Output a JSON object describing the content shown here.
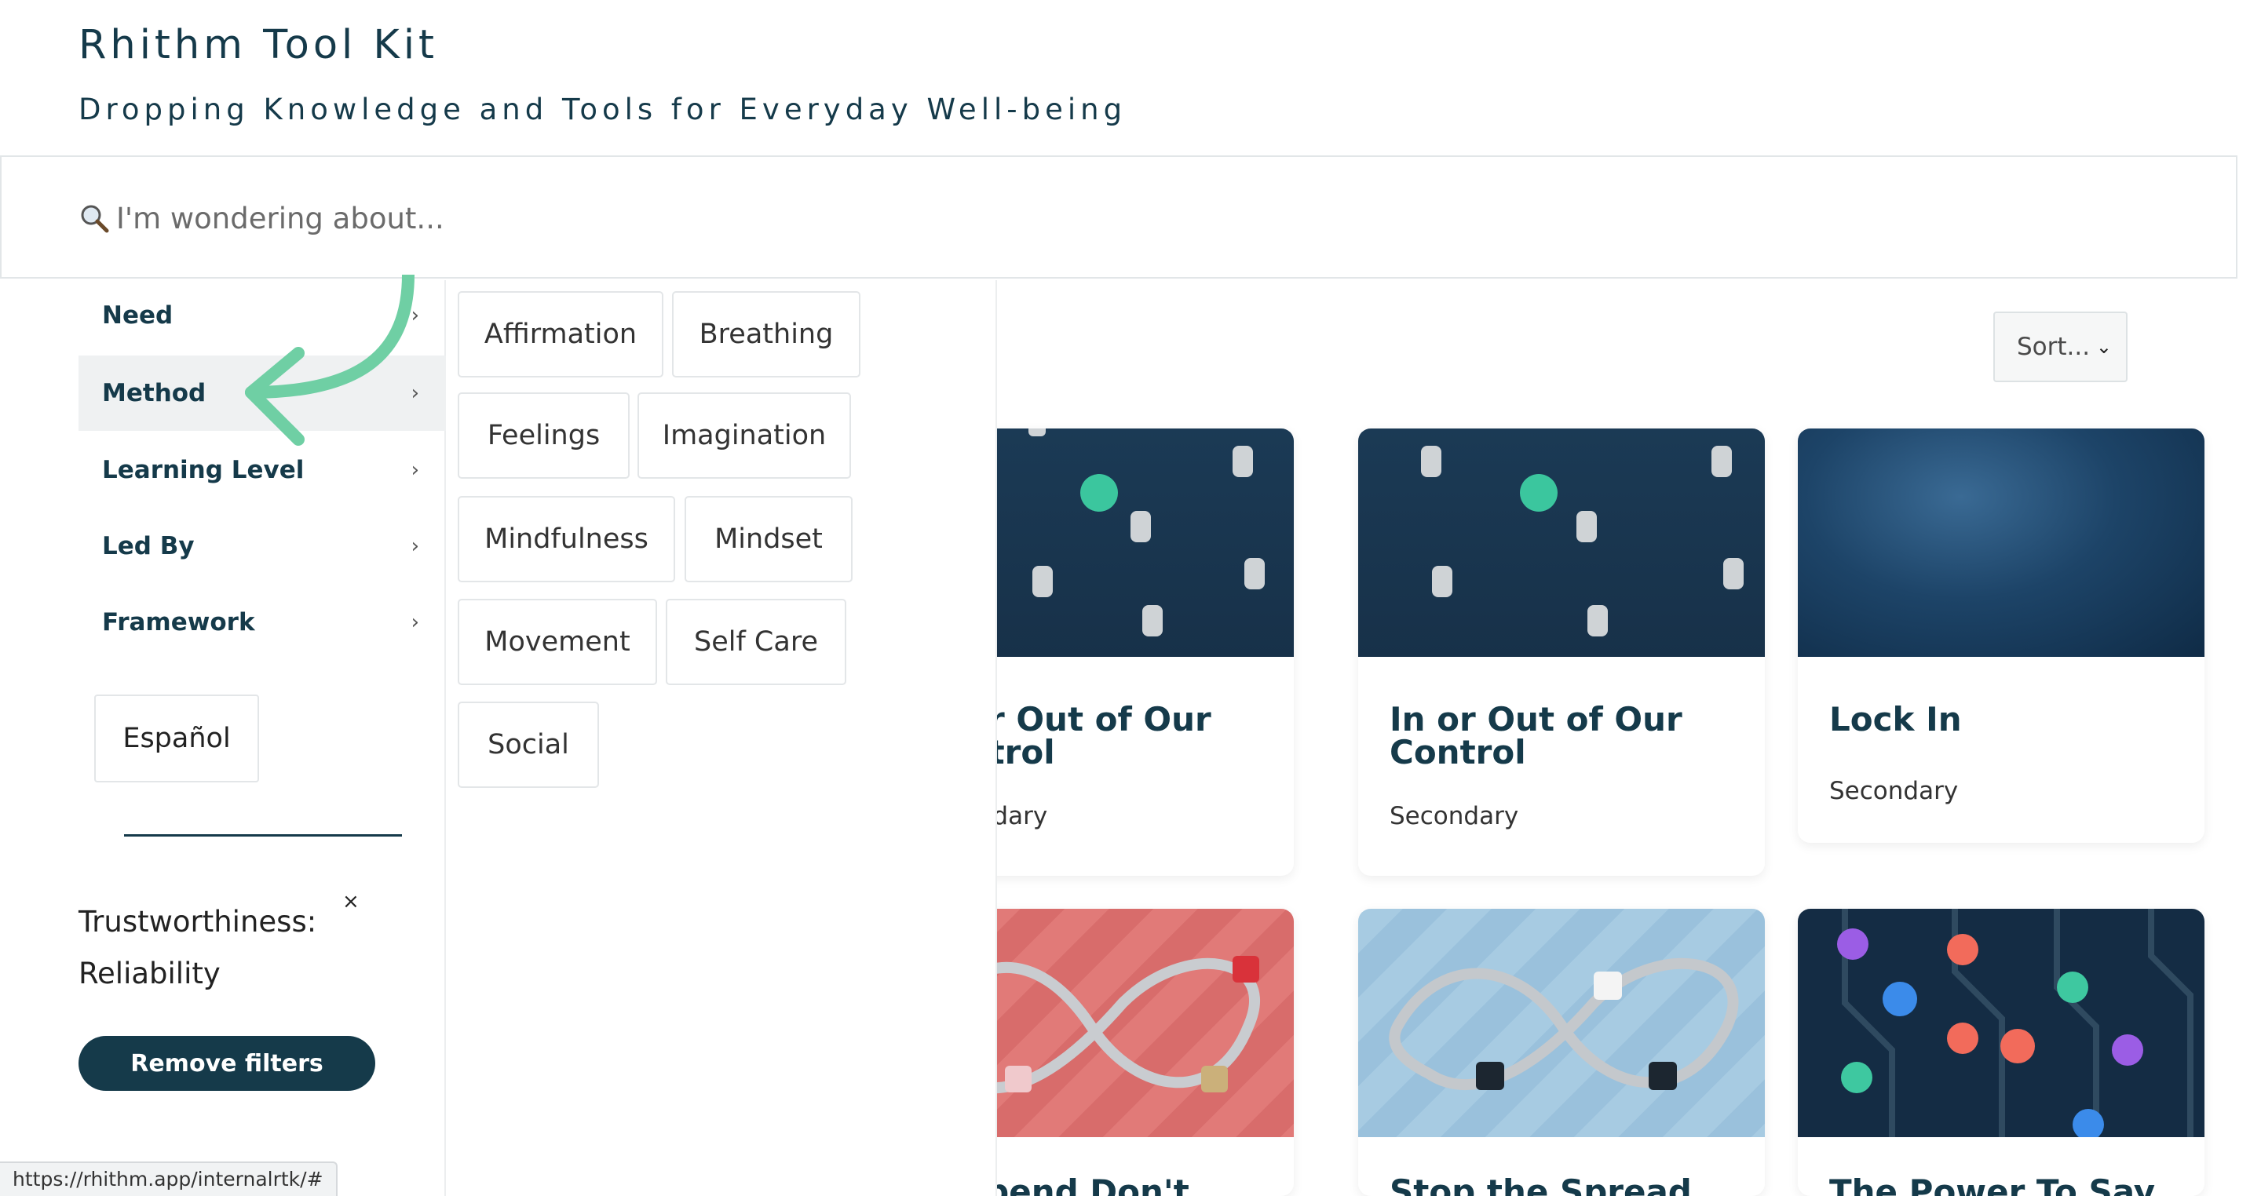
{
  "header": {
    "title": "Rhithm Tool Kit",
    "subtitle": "Dropping Knowledge and Tools for Everyday Well-being"
  },
  "search": {
    "placeholder": "I'm wondering about...",
    "icon": "magnifier-icon"
  },
  "sort": {
    "label": "Sort..."
  },
  "filters": {
    "categories": [
      {
        "label": "Need"
      },
      {
        "label": "Method"
      },
      {
        "label": "Learning Level"
      },
      {
        "label": "Led By"
      },
      {
        "label": "Framework"
      }
    ],
    "active_category": "Method",
    "language_button": "Español",
    "active_filter_line1": "Trustworthiness:",
    "active_filter_line2": "Reliability",
    "close_symbol": "×",
    "remove_label": "Remove filters"
  },
  "method_options": [
    "Affirmation",
    "Breathing",
    "Feelings",
    "Imagination",
    "Mindfulness",
    "Mindset",
    "Movement",
    "Self Care",
    "Social"
  ],
  "cards": [
    {
      "title": "In or Out of Our Control",
      "level": "Secondary"
    },
    {
      "title": "In or Out of Our Control",
      "level": "Secondary"
    },
    {
      "title": "Lock In",
      "level": "Secondary"
    },
    {
      "title": "Suspend Don't",
      "level": ""
    },
    {
      "title": "Stop the Spread",
      "level": ""
    },
    {
      "title": "The Power To Say",
      "level": ""
    }
  ],
  "status_url": "https://rhithm.app/internalrtk/#",
  "colors": {
    "brand": "#153a4a",
    "arrow": "#6fcfa4"
  }
}
